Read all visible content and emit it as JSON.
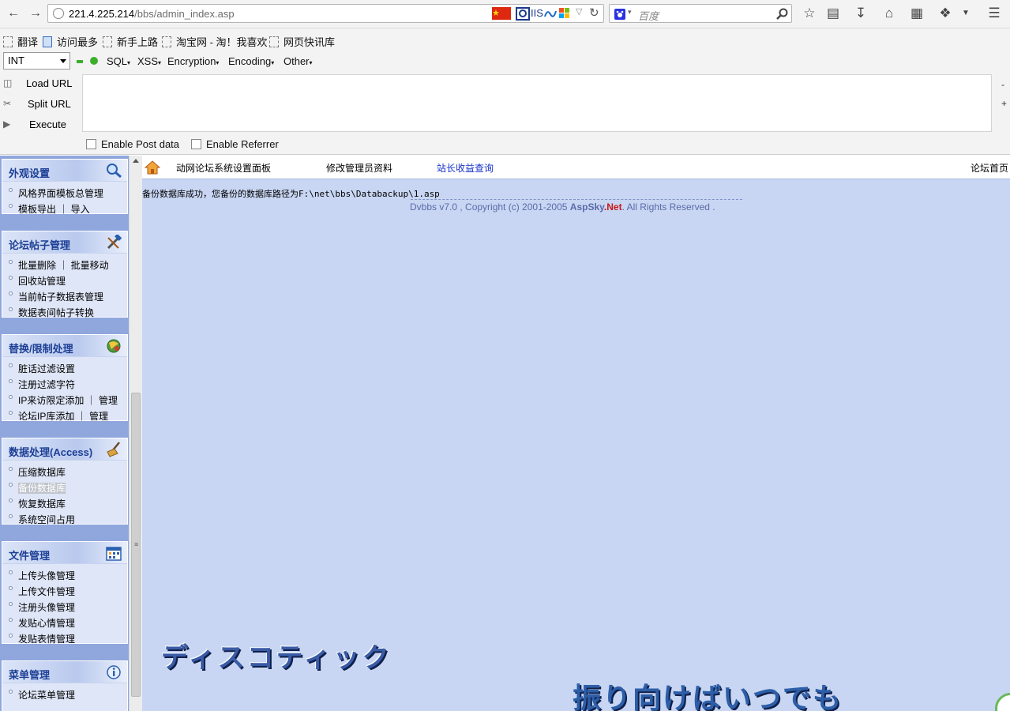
{
  "browser": {
    "url_host": "221.4.225.214",
    "url_path": "/bbs/admin_index.asp",
    "search_placeholder": "百度",
    "iis_label": "IIS"
  },
  "bookmarks": [
    {
      "label": "翻译"
    },
    {
      "label": "访问最多"
    },
    {
      "label": "新手上路"
    },
    {
      "label": "淘宝网 - 淘！我喜欢"
    },
    {
      "label": "网页快讯库"
    }
  ],
  "hackbar": {
    "select_value": "INT",
    "menus": [
      "SQL",
      "XSS",
      "Encryption",
      "Encoding",
      "Other"
    ],
    "actions": [
      "Load URL",
      "Split URL",
      "Execute"
    ],
    "textarea_value": "",
    "enable_post": "Enable Post data",
    "enable_referrer": "Enable Referrer",
    "minus": "-",
    "plus": "+"
  },
  "sidebar": {
    "sections": [
      {
        "title": "外观设置",
        "icon": "magnifier-icon",
        "items": [
          "风格界面模板总管理",
          "模板导出 ｜ 导入"
        ]
      },
      {
        "title": "论坛帖子管理",
        "icon": "tools-icon",
        "items": [
          "批量删除 ｜ 批量移动",
          "回收站管理",
          "当前帖子数据表管理",
          "数据表间帖子转换"
        ]
      },
      {
        "title": "替换/限制处理",
        "icon": "globe-icon",
        "items": [
          "脏话过滤设置",
          "注册过滤字符",
          "IP来访限定添加 ｜ 管理",
          "论坛IP库添加 ｜ 管理"
        ]
      },
      {
        "title": "数据处理(Access)",
        "icon": "broom-icon",
        "items": [
          "压缩数据库",
          "备份数据库",
          "恢复数据库",
          "系统空间占用"
        ]
      },
      {
        "title": "文件管理",
        "icon": "calendar-icon",
        "items": [
          "上传头像管理",
          "上传文件管理",
          "注册头像管理",
          "发贴心情管理",
          "发贴表情管理"
        ]
      },
      {
        "title": "菜单管理",
        "icon": "info-icon",
        "items": [
          "论坛菜单管理"
        ]
      }
    ],
    "active_item": "备份数据库"
  },
  "main": {
    "topnav": [
      "动网论坛系统设置面板",
      "修改管理员资料",
      "站长收益查询",
      "论坛首页"
    ],
    "message": "备份数据库成功，您备份的数据库路径为F:\\net\\bbs\\Databackup\\1.asp",
    "copyright_prefix": "Dvbbs v7.0 , Copyright (c) 2001-2005 ",
    "copyright_brand": "AspSky",
    "copyright_net": ".Net",
    "copyright_suffix": ". All Rights Reserved .",
    "banner_line1": "ディスコティック",
    "banner_line2": "振り向けばいつでも"
  },
  "colors": {
    "main_bg": "#c8d6f3",
    "sidebar_bg": "#8fa7dd",
    "menu_title": "#1c3f95",
    "link_blue": "#1430c8"
  }
}
